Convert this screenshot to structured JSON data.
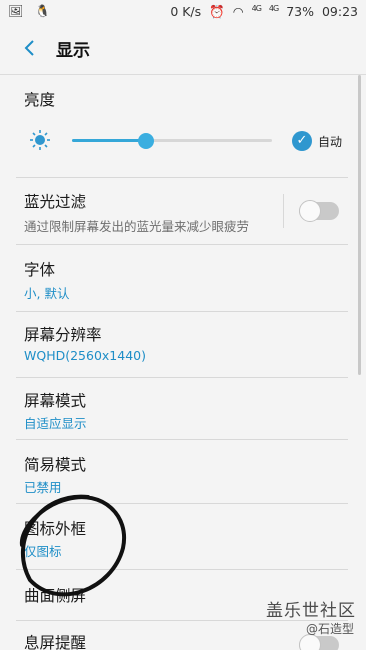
{
  "status_bar": {
    "left_icons": [
      "image-icon",
      "qq-icon"
    ],
    "net_speed": "0 K/s",
    "icons": [
      "alarm-icon",
      "wifi-icon"
    ],
    "sig1": "4G",
    "sig2": "4G",
    "battery": "73%",
    "time": "09:23"
  },
  "header": {
    "title": "显示",
    "back_icon": "back-arrow-icon"
  },
  "brightness": {
    "label": "亮度",
    "level": 0.37,
    "auto_label": "自动",
    "auto_checked": true
  },
  "items": [
    {
      "label": "蓝光过滤",
      "sub": "通过限制屏幕发出的蓝光量来减少眼疲劳",
      "sub_style": "gray",
      "toggle": false
    },
    {
      "label": "字体",
      "sub": "小, 默认"
    },
    {
      "label": "屏幕分辨率",
      "sub": "WQHD(2560x1440)"
    },
    {
      "label": "屏幕模式",
      "sub": "自适应显示"
    },
    {
      "label": "简易模式",
      "sub": "已禁用"
    },
    {
      "label": "图标外框",
      "sub": "仅图标"
    },
    {
      "label": "曲面侧屏",
      "sub": ""
    },
    {
      "label": "息屏提醒",
      "sub": ""
    }
  ],
  "watermark": {
    "line1": "盖乐世社区",
    "line2": "@石造型"
  },
  "colors": {
    "accent": "#1e8ec7",
    "background": "#f4f4f4"
  }
}
